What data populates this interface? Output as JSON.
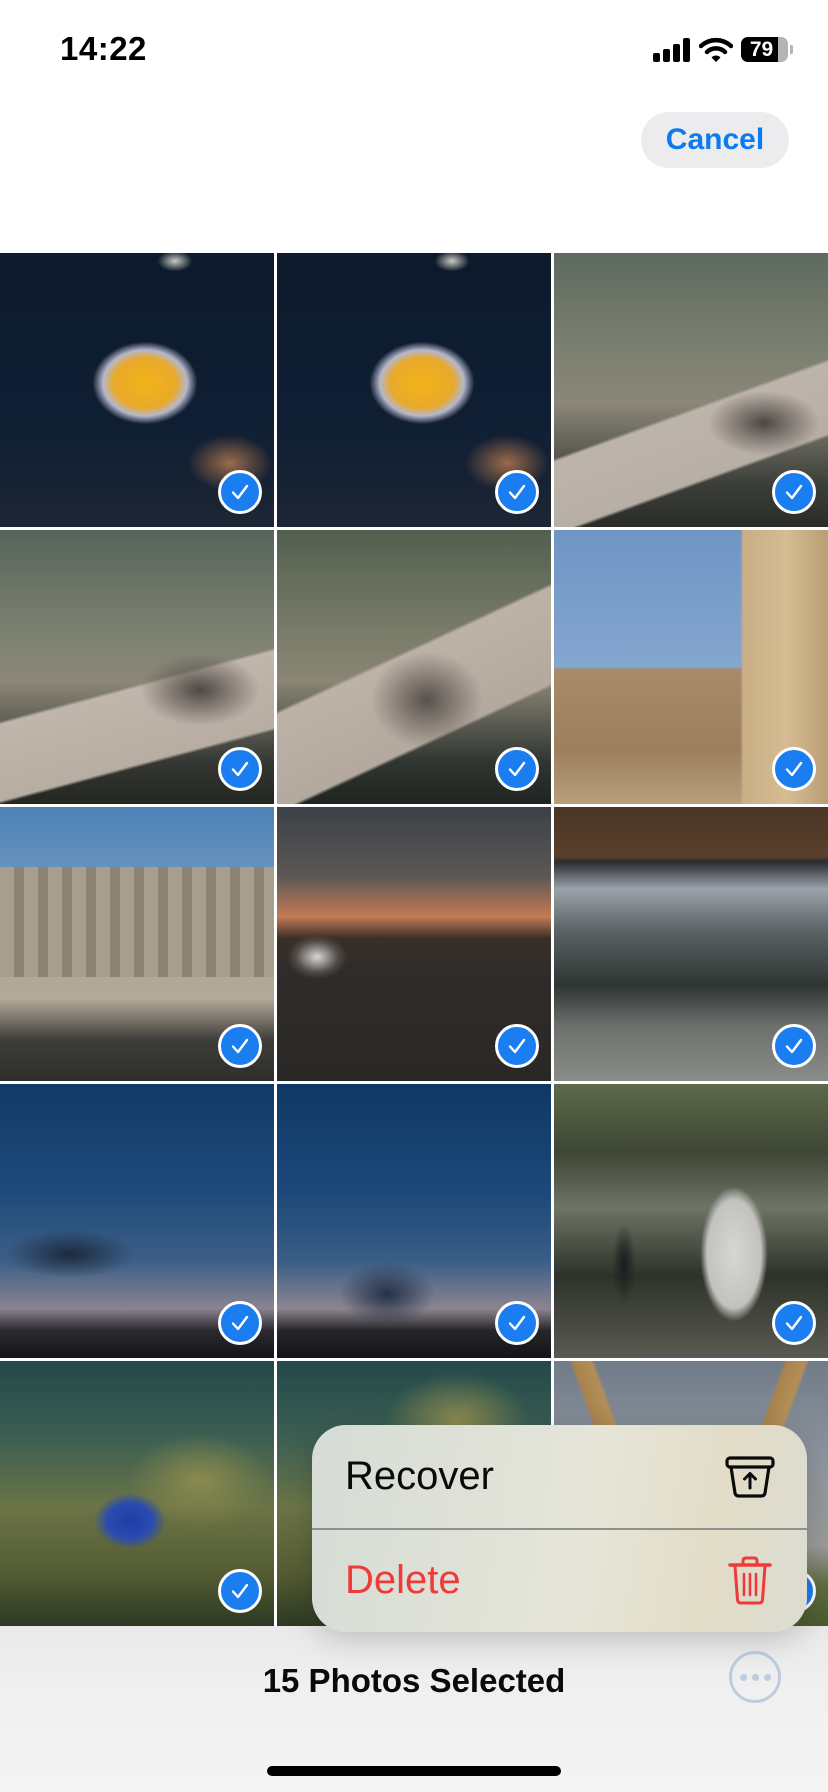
{
  "status_bar": {
    "time": "14:22",
    "battery_percent": "79",
    "battery_level": 0.79,
    "icons": [
      "signal-icon",
      "wifi-icon",
      "battery-icon"
    ]
  },
  "header": {
    "cancel_label": "Cancel"
  },
  "colors": {
    "accent": "#0a7cf0",
    "destructive": "#ef3a39",
    "check_badge": "#1a7ef0"
  },
  "photos": [
    {
      "subject": "butterflyfish",
      "selected": true
    },
    {
      "subject": "butterflyfish",
      "selected": true
    },
    {
      "subject": "otters",
      "selected": true
    },
    {
      "subject": "otters",
      "selected": true
    },
    {
      "subject": "otter",
      "selected": true
    },
    {
      "subject": "temple statue",
      "selected": true
    },
    {
      "subject": "temple columns",
      "selected": true
    },
    {
      "subject": "road at dusk",
      "selected": true
    },
    {
      "subject": "icicles",
      "selected": true
    },
    {
      "subject": "evening sky",
      "selected": true
    },
    {
      "subject": "evening sky",
      "selected": true
    },
    {
      "subject": "pelican",
      "selected": true
    },
    {
      "subject": "coral reef fish",
      "selected": true
    },
    {
      "subject": "coral reef",
      "selected": true
    },
    {
      "subject": "wooden structure",
      "selected": true
    }
  ],
  "context_menu": {
    "items": [
      {
        "label": "Recover",
        "icon": "recover-tray-icon"
      },
      {
        "label": "Delete",
        "icon": "trash-icon"
      }
    ]
  },
  "toolbar": {
    "selected_count_text": "15 Photos Selected",
    "more_icon": "ellipsis-circle-icon"
  }
}
